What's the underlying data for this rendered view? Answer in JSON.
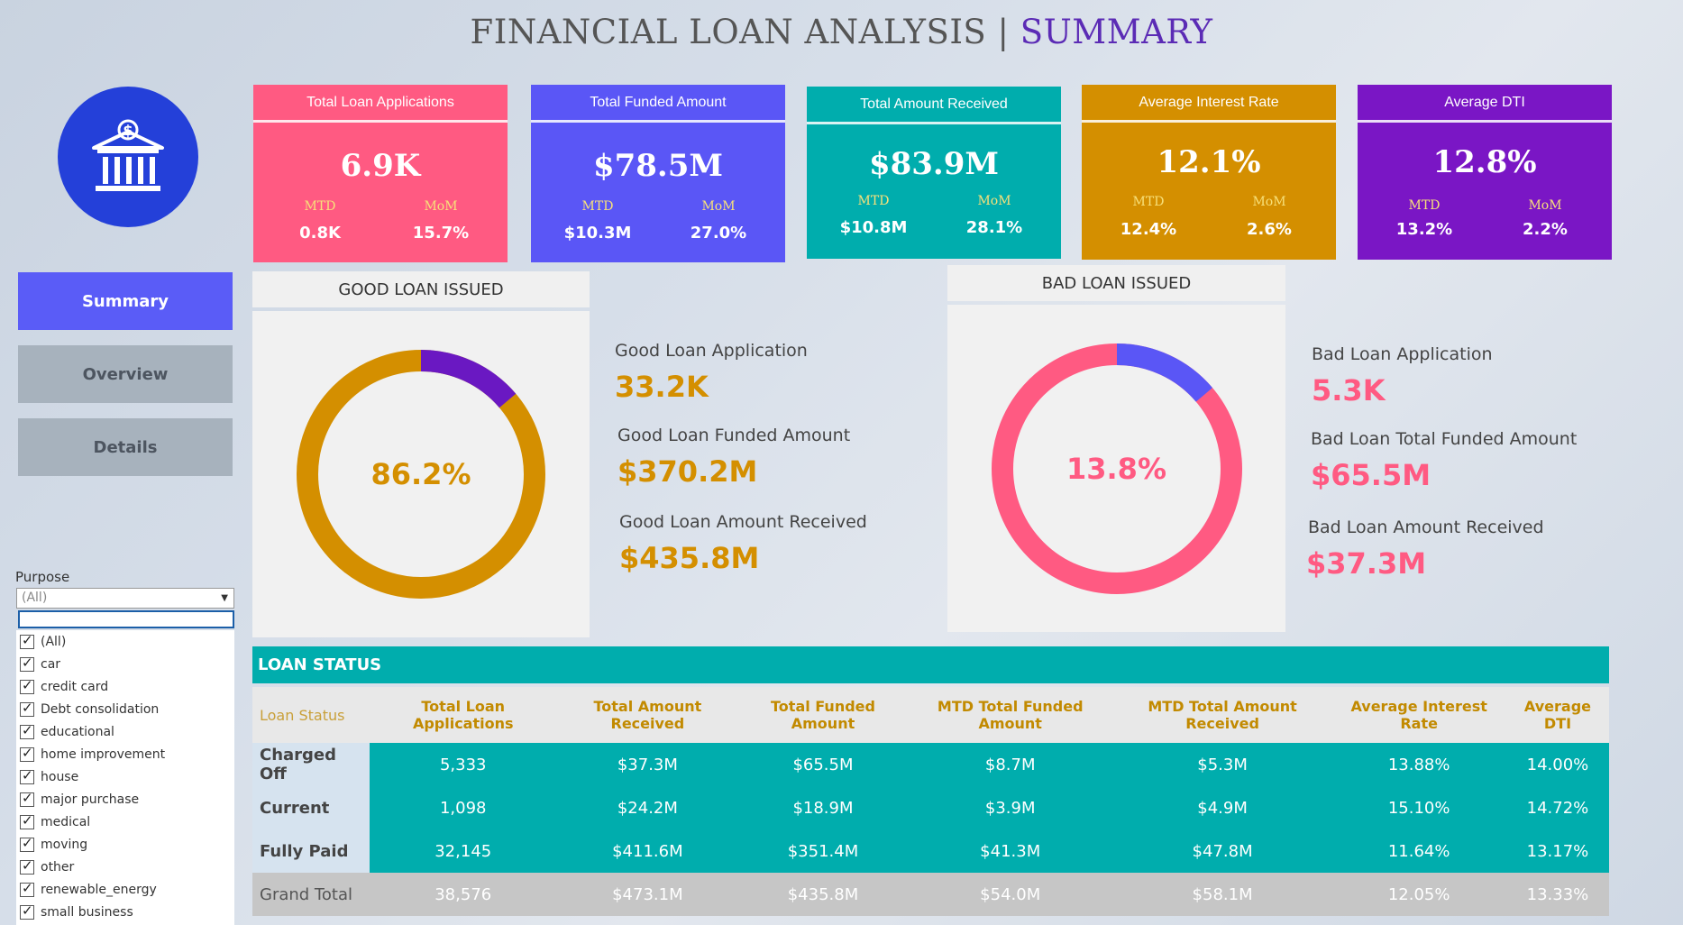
{
  "header": {
    "title_main": "FINANCIAL LOAN ANALYSIS | ",
    "title_accent": "SUMMARY"
  },
  "logo": {
    "icon": "bank-dollar-icon"
  },
  "nav": {
    "summary": "Summary",
    "overview": "Overview",
    "details": "Details"
  },
  "kpis": [
    {
      "title": "Total Loan Applications",
      "value": "6.9K",
      "mtd_label": "MTD",
      "mtd": "0.8K",
      "mom_label": "MoM",
      "mom": "15.7%",
      "color": "#ff5a82"
    },
    {
      "title": "Total Funded Amount",
      "value": "$78.5M",
      "mtd_label": "MTD",
      "mtd": "$10.3M",
      "mom_label": "MoM",
      "mom": "27.0%",
      "color": "#5a56f6"
    },
    {
      "title": "Total Amount Received",
      "value": "$83.9M",
      "mtd_label": "MTD",
      "mtd": "$10.8M",
      "mom_label": "MoM",
      "mom": "28.1%",
      "color": "#00adad"
    },
    {
      "title": "Average Interest Rate",
      "value": "12.1%",
      "mtd_label": "MTD",
      "mtd": "12.4%",
      "mom_label": "MoM",
      "mom": "2.6%",
      "color": "#d48f00"
    },
    {
      "title": "Average DTI",
      "value": "12.8%",
      "mtd_label": "MTD",
      "mtd": "13.2%",
      "mom_label": "MoM",
      "mom": "2.2%",
      "color": "#7a16c5"
    }
  ],
  "good_loan": {
    "title": "GOOD LOAN ISSUED",
    "percent_label": "86.2%",
    "percent": 86.2,
    "main_color": "#d48f00",
    "rest_color": "#6a18c2",
    "app_label": "Good Loan Application",
    "app_value": "33.2K",
    "funded_label": "Good Loan Funded Amount",
    "funded_value": "$370.2M",
    "received_label": "Good Loan Amount Received",
    "received_value": "$435.8M"
  },
  "bad_loan": {
    "title": "BAD LOAN ISSUED",
    "percent_label": "13.8%",
    "percent": 13.8,
    "main_color": "#ff5a82",
    "rest_color": "#5a56f6",
    "app_label": "Bad Loan Application",
    "app_value": "5.3K",
    "funded_label": "Bad Loan Total Funded Amount",
    "funded_value": "$65.5M",
    "received_label": "Bad Loan Amount Received",
    "received_value": "$37.3M"
  },
  "filter": {
    "label": "Purpose",
    "selected": "(All)",
    "items": [
      "(All)",
      "car",
      "credit card",
      "Debt consolidation",
      "educational",
      "home improvement",
      "house",
      "major purchase",
      "medical",
      "moving",
      "other",
      "renewable_energy",
      "small business"
    ]
  },
  "loan_status": {
    "title": "LOAN STATUS",
    "columns": [
      "Loan Status",
      "Total Loan Applications",
      "Total Amount Received",
      "Total Funded Amount",
      "MTD Total Funded Amount",
      "MTD Total Amount Received",
      "Average Interest Rate",
      "Average DTI"
    ],
    "rows": [
      [
        "Charged Off",
        "5,333",
        "$37.3M",
        "$65.5M",
        "$8.7M",
        "$5.3M",
        "13.88%",
        "14.00%"
      ],
      [
        "Current",
        "1,098",
        "$24.2M",
        "$18.9M",
        "$3.9M",
        "$4.9M",
        "15.10%",
        "14.72%"
      ],
      [
        "Fully Paid",
        "32,145",
        "$411.6M",
        "$351.4M",
        "$41.3M",
        "$47.8M",
        "11.64%",
        "13.17%"
      ]
    ],
    "total": [
      "Grand Total",
      "38,576",
      "$473.1M",
      "$435.8M",
      "$54.0M",
      "$58.1M",
      "12.05%",
      "13.33%"
    ]
  }
}
